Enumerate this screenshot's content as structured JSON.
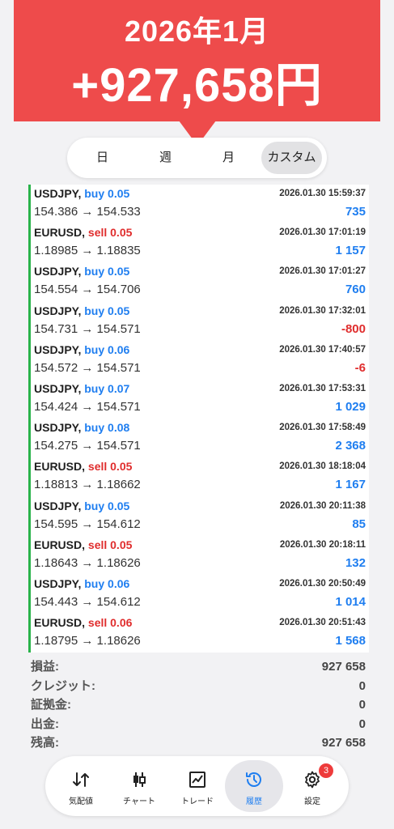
{
  "banner": {
    "title": "2026年1月",
    "amount": "+927,658円"
  },
  "period_tabs": [
    {
      "label": "日",
      "active": false
    },
    {
      "label": "週",
      "active": false
    },
    {
      "label": "月",
      "active": false
    },
    {
      "label": "カスタム",
      "active": true
    }
  ],
  "deals": [
    {
      "symbol": "USDJPY,",
      "type": "buy",
      "volume": "buy 0.05",
      "prices": "154.386 → 154.533",
      "time": "2026.01.30 15:59:37",
      "profit": "735"
    },
    {
      "symbol": "EURUSD,",
      "type": "sell",
      "volume": "sell 0.05",
      "prices": "1.18985 → 1.18835",
      "time": "2026.01.30 17:01:19",
      "profit": "1 157"
    },
    {
      "symbol": "USDJPY,",
      "type": "buy",
      "volume": "buy 0.05",
      "prices": "154.554 → 154.706",
      "time": "2026.01.30 17:01:27",
      "profit": "760"
    },
    {
      "symbol": "USDJPY,",
      "type": "buy",
      "volume": "buy 0.05",
      "prices": "154.731 → 154.571",
      "time": "2026.01.30 17:32:01",
      "profit": "-800"
    },
    {
      "symbol": "USDJPY,",
      "type": "buy",
      "volume": "buy 0.06",
      "prices": "154.572 → 154.571",
      "time": "2026.01.30 17:40:57",
      "profit": "-6"
    },
    {
      "symbol": "USDJPY,",
      "type": "buy",
      "volume": "buy 0.07",
      "prices": "154.424 → 154.571",
      "time": "2026.01.30 17:53:31",
      "profit": "1 029"
    },
    {
      "symbol": "USDJPY,",
      "type": "buy",
      "volume": "buy 0.08",
      "prices": "154.275 → 154.571",
      "time": "2026.01.30 17:58:49",
      "profit": "2 368"
    },
    {
      "symbol": "EURUSD,",
      "type": "sell",
      "volume": "sell 0.05",
      "prices": "1.18813 → 1.18662",
      "time": "2026.01.30 18:18:04",
      "profit": "1 167"
    },
    {
      "symbol": "USDJPY,",
      "type": "buy",
      "volume": "buy 0.05",
      "prices": "154.595 → 154.612",
      "time": "2026.01.30 20:11:38",
      "profit": "85"
    },
    {
      "symbol": "EURUSD,",
      "type": "sell",
      "volume": "sell 0.05",
      "prices": "1.18643 → 1.18626",
      "time": "2026.01.30 20:18:11",
      "profit": "132"
    },
    {
      "symbol": "USDJPY,",
      "type": "buy",
      "volume": "buy 0.06",
      "prices": "154.443 → 154.612",
      "time": "2026.01.30 20:50:49",
      "profit": "1 014"
    },
    {
      "symbol": "EURUSD,",
      "type": "sell",
      "volume": "sell 0.06",
      "prices": "1.18795 → 1.18626",
      "time": "2026.01.30 20:51:43",
      "profit": "1 568"
    }
  ],
  "summary": [
    {
      "label": "損益:",
      "value": "927 658"
    },
    {
      "label": "クレジット:",
      "value": "0"
    },
    {
      "label": "証拠金:",
      "value": "0"
    },
    {
      "label": "出金:",
      "value": "0"
    },
    {
      "label": "残高:",
      "value": "927 658"
    }
  ],
  "nav": [
    {
      "label": "気配値",
      "icon": "quotes-icon",
      "active": false
    },
    {
      "label": "チャート",
      "icon": "chart-icon",
      "active": false
    },
    {
      "label": "トレード",
      "icon": "trade-icon",
      "active": false
    },
    {
      "label": "履歴",
      "icon": "history-icon",
      "active": true
    },
    {
      "label": "設定",
      "icon": "gear-icon",
      "active": false,
      "badge": "3"
    }
  ],
  "colors": {
    "banner": "#ee4b4b",
    "buy": "#1f7ef0",
    "sell": "#e02d2d",
    "accent_line": "#29b34a"
  }
}
